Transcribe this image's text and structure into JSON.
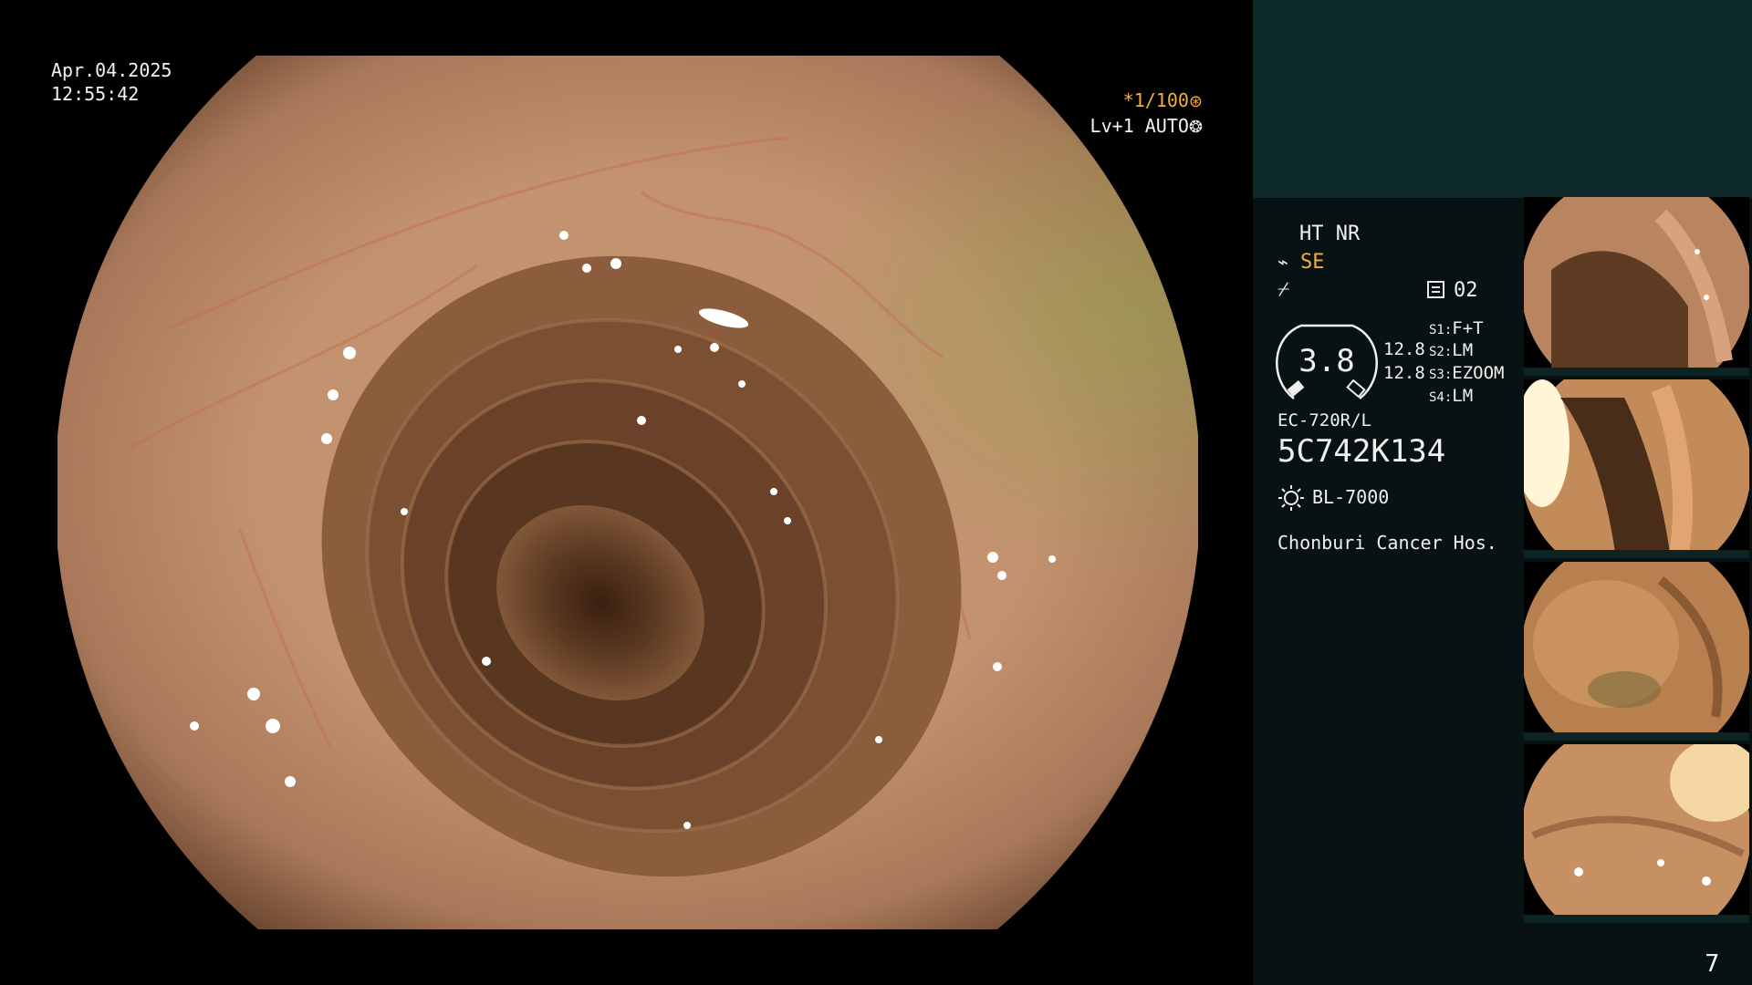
{
  "overlay": {
    "date": "Apr.04.2025",
    "time": "12:55:42",
    "shutter": "*1/100",
    "shutter_icon": "shutter-icon",
    "level": "Lv+1 AUTO",
    "level_icon": "iris-icon"
  },
  "panel": {
    "mode": "HT NR",
    "enhance": "SE",
    "enhance_icon": "structure-enhance-icon",
    "memo_icon": "memo-icon",
    "memo_value": "02",
    "zoom_value": "3.8",
    "gauge_val_1": "12.8",
    "gauge_val_2": "12.8",
    "switches": [
      {
        "key": "S1",
        "value": "F+T"
      },
      {
        "key": "S2",
        "value": "LM"
      },
      {
        "key": "S3",
        "value": "EZOOM"
      },
      {
        "key": "S4",
        "value": "LM"
      }
    ],
    "scope_model": "EC-720R/L",
    "scope_serial": "5C742K134",
    "light_icon": "light-source-icon",
    "light_source": "BL-7000",
    "hospital": "Chonburi Cancer Hos."
  },
  "colors": {
    "panel_bg": "#081212",
    "panel_top": "#0e2a2a",
    "accent_orange": "#f2b13c"
  },
  "page_number": "7"
}
